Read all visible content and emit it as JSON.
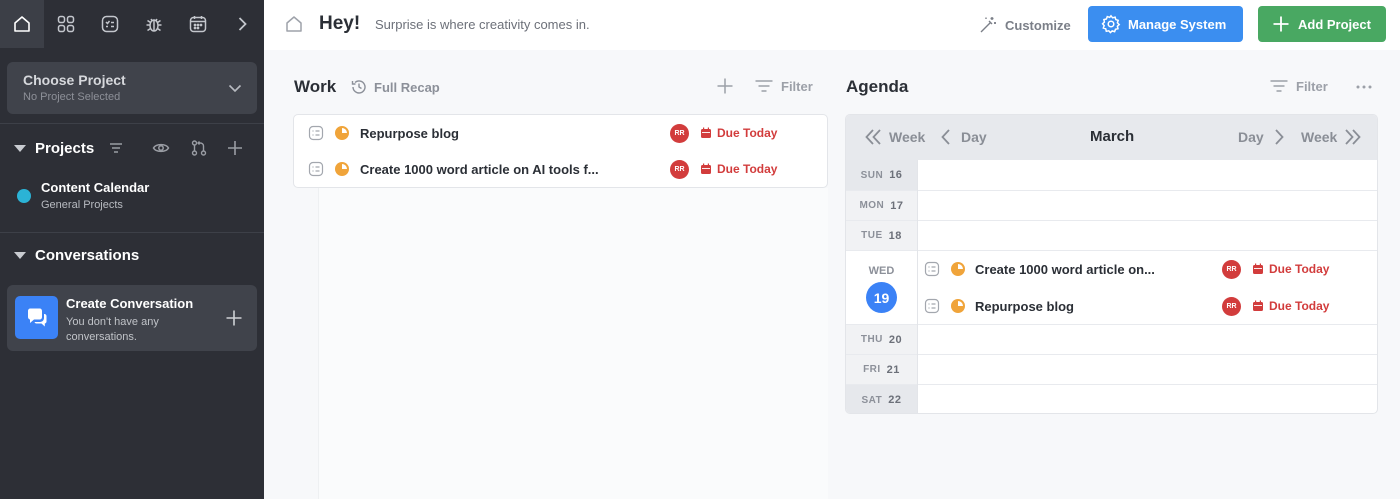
{
  "sidebar": {
    "top_icons": [
      "home-icon",
      "apps-grid-icon",
      "tasks-icon",
      "bug-icon",
      "calendar-icon",
      "chevron-right-icon"
    ],
    "choose_project": {
      "title": "Choose Project",
      "subtitle": "No Project Selected"
    },
    "projects": {
      "heading": "Projects",
      "items": [
        {
          "name": "Content Calendar",
          "subtitle": "General Projects",
          "color": "#2bb3d6"
        }
      ]
    },
    "conversations": {
      "heading": "Conversations",
      "card": {
        "title": "Create Conversation",
        "subtitle": "You don't have any conversations."
      }
    }
  },
  "header": {
    "greeting": "Hey!",
    "message": "Surprise is where creativity comes in.",
    "customize_label": "Customize",
    "manage_label": "Manage System",
    "add_project_label": "Add Project"
  },
  "work": {
    "title": "Work",
    "recap_label": "Full Recap",
    "filter_label": "Filter",
    "tasks": [
      {
        "name": "Repurpose blog",
        "assignee": "RR",
        "due": "Due Today"
      },
      {
        "name": "Create 1000 word article on AI tools f...",
        "assignee": "RR",
        "due": "Due Today"
      }
    ]
  },
  "agenda": {
    "title": "Agenda",
    "filter_label": "Filter",
    "nav": {
      "prev_week": "Week",
      "prev_day": "Day",
      "month": "March",
      "next_day": "Day",
      "next_week": "Week"
    },
    "days": [
      {
        "wd": "SUN",
        "d": "16"
      },
      {
        "wd": "MON",
        "d": "17"
      },
      {
        "wd": "TUE",
        "d": "18"
      },
      {
        "wd": "WED",
        "d": "19"
      },
      {
        "wd": "THU",
        "d": "20"
      },
      {
        "wd": "FRI",
        "d": "21"
      },
      {
        "wd": "SAT",
        "d": "22"
      }
    ],
    "today_tasks": [
      {
        "name": "Create 1000 word article on...",
        "assignee": "RR",
        "due": "Due Today"
      },
      {
        "name": "Repurpose blog",
        "assignee": "RR",
        "due": "Due Today"
      }
    ]
  },
  "colors": {
    "accent_blue": "#3b8ef0",
    "accent_green": "#49a862",
    "due_red": "#d23c3c",
    "sidebar_bg": "#2d2f36"
  }
}
